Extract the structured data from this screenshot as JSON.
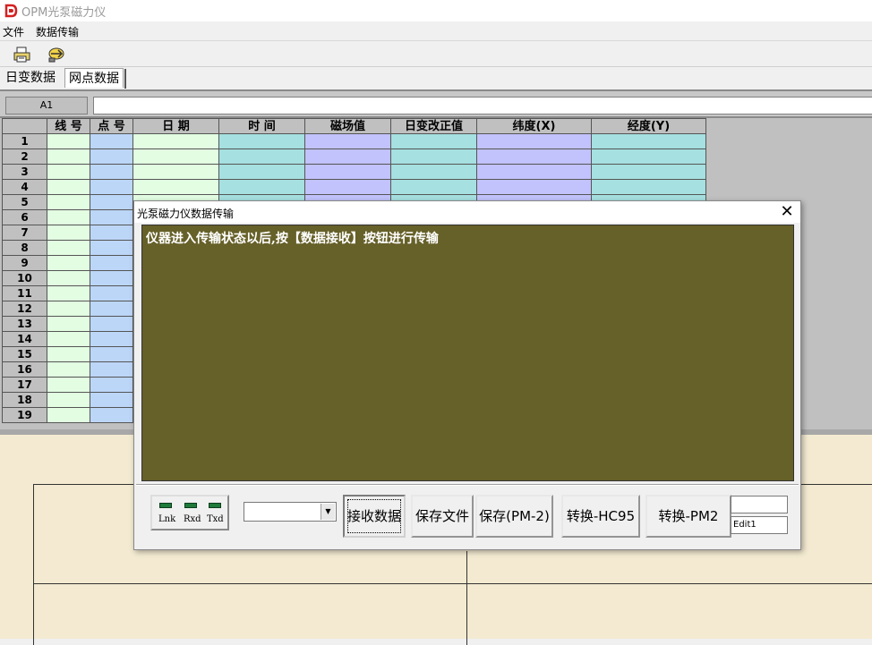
{
  "app": {
    "title": "OPM光泵磁力仪"
  },
  "menu": {
    "items": [
      "文件",
      "数据传输"
    ]
  },
  "tabs": [
    "日变数据",
    "网点数据"
  ],
  "cellbar": {
    "ref": "A1",
    "value": ""
  },
  "grid": {
    "headers": [
      "线 号",
      "点 号",
      "日 期",
      "时 间",
      "磁场值",
      "日变改正值",
      "纬度(X)",
      "经度(Y)"
    ],
    "row_numbers": [
      "1",
      "2",
      "3",
      "4",
      "5",
      "6",
      "7",
      "8",
      "9",
      "10",
      "11",
      "12",
      "13",
      "14",
      "15",
      "16",
      "17",
      "18",
      "19"
    ]
  },
  "dialog": {
    "title": "光泵磁力仪数据传输",
    "message": "仪器进入传输状态以后,按【数据接收】按钮进行传输",
    "leds": [
      "Lnk",
      "Rxd",
      "Txd"
    ],
    "port_value": "",
    "buttons": {
      "receive": "接收数据",
      "save_file": "保存文件",
      "save_pm2": "保存(PM-2)",
      "convert_hc95": "转换-HC95",
      "convert_pm2": "转换-PM2"
    },
    "edit_top": "",
    "edit1": "Edit1"
  },
  "colors": {
    "log_background": "#666029",
    "col_line": "#e2fde2",
    "col_point": "#bcd6f8",
    "col_time": "#a6e0e0",
    "col_mag": "#c2c2fc",
    "lower_background": "#f3ead1",
    "led": "#1f7a3a"
  },
  "icons": [
    "app-logo-icon",
    "print-icon",
    "transfer-icon",
    "close-icon",
    "dropdown-arrow-icon"
  ]
}
